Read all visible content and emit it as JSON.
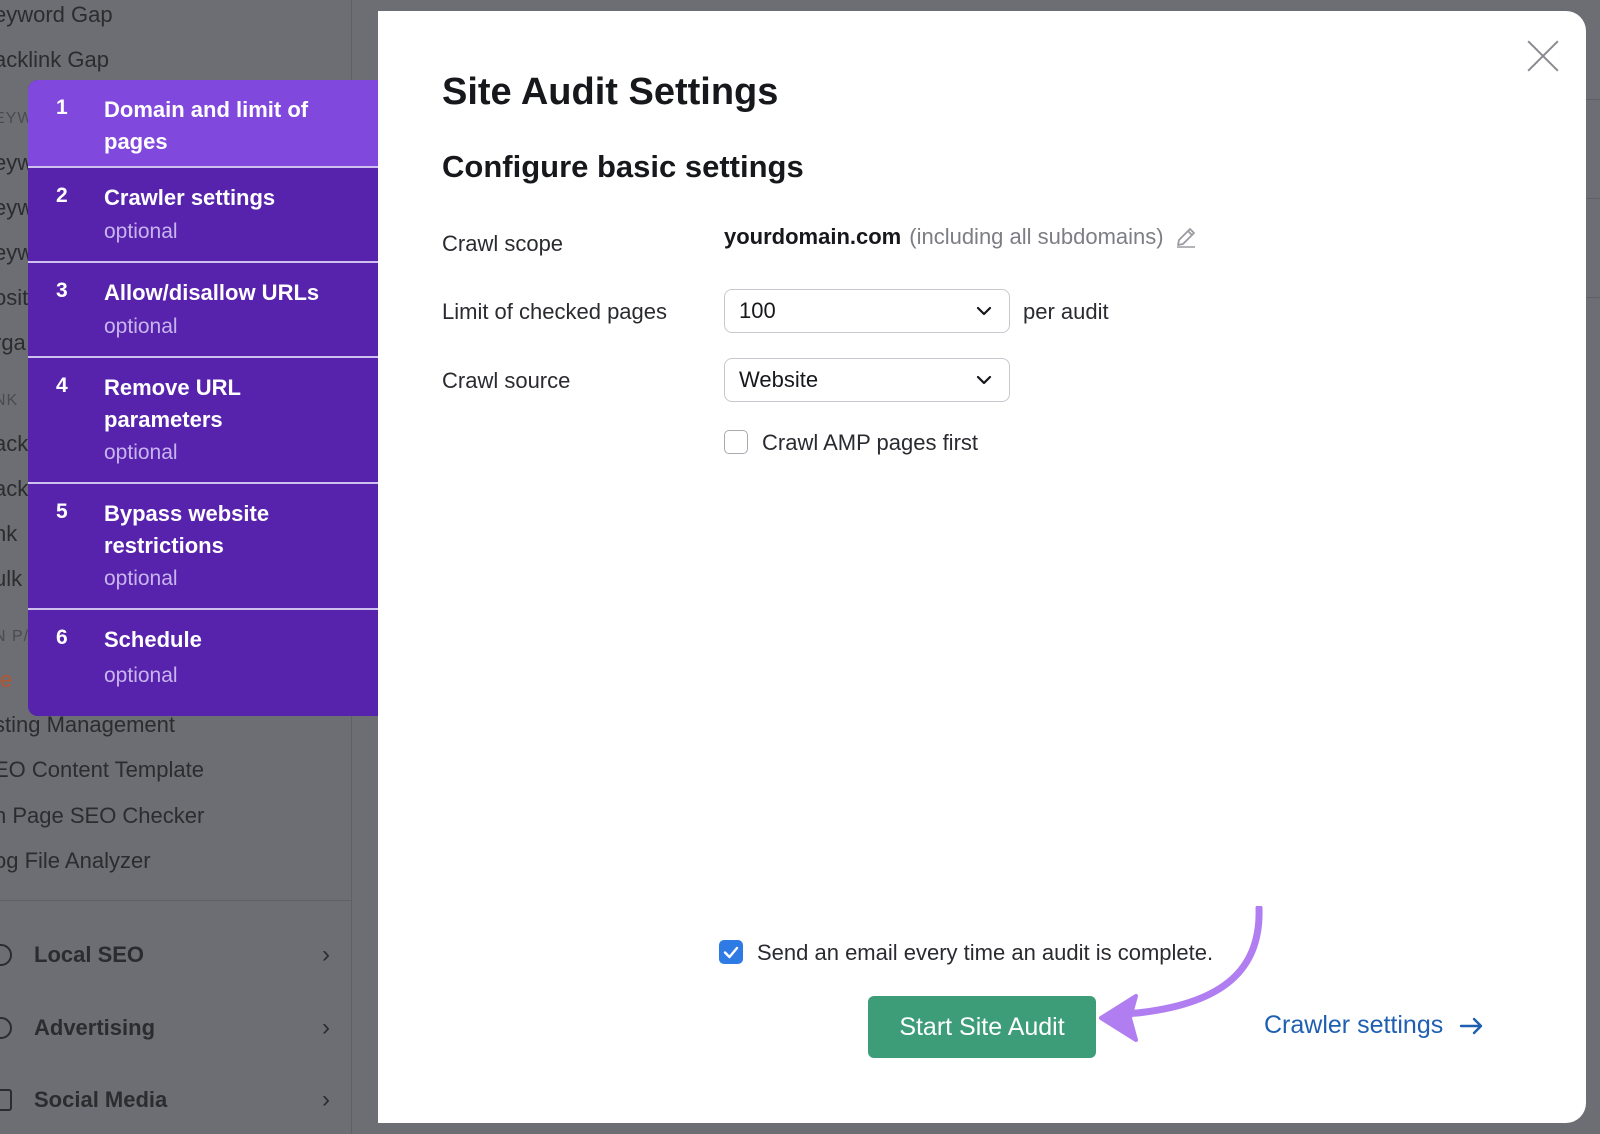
{
  "background": {
    "items": [
      "eyword Gap",
      "acklink Gap"
    ],
    "section_keyword": "EYW",
    "partial": [
      "eyw",
      "eyw",
      "eyw",
      "osit",
      "rga"
    ],
    "section_link": "NK",
    "partial2": [
      "ack",
      "ack",
      "nk",
      "ulk"
    ],
    "section_onpage": "N P/",
    "orange": "te",
    "items2": [
      "sting Management",
      "EO Content Template",
      "n Page SEO Checker",
      "og File Analyzer"
    ],
    "nav": [
      {
        "label": "Local SEO"
      },
      {
        "label": "Advertising"
      },
      {
        "label": "Social Media"
      }
    ]
  },
  "steps": [
    {
      "num": "1",
      "title": "Domain and limit of pages",
      "optional": ""
    },
    {
      "num": "2",
      "title": "Crawler settings",
      "optional": "optional"
    },
    {
      "num": "3",
      "title": "Allow/disallow URLs",
      "optional": "optional"
    },
    {
      "num": "4",
      "title": "Remove URL parameters",
      "optional": "optional"
    },
    {
      "num": "5",
      "title": "Bypass website restrictions",
      "optional": "optional"
    },
    {
      "num": "6",
      "title": "Schedule",
      "optional": "optional"
    }
  ],
  "modal": {
    "title": "Site Audit Settings",
    "subtitle": "Configure basic settings",
    "crawl_scope_label": "Crawl scope",
    "domain": "yourdomain.com",
    "domain_note": "(including all subdomains)",
    "limit_label": "Limit of checked pages",
    "limit_value": "100",
    "per_audit": "per audit",
    "source_label": "Crawl source",
    "source_value": "Website",
    "amp_label": "Crawl AMP pages first",
    "amp_checked": false,
    "email_label": "Send an email every time an audit is complete.",
    "email_checked": true,
    "start_button": "Start Site Audit",
    "crawler_link": "Crawler settings"
  },
  "colors": {
    "step_active": "#8048dd",
    "step_inactive": "#5723ad",
    "start_button": "#3c9d78",
    "link": "#1f5fb1",
    "annotation_arrow": "#b07ef0",
    "checkbox_on": "#2f7be5"
  }
}
